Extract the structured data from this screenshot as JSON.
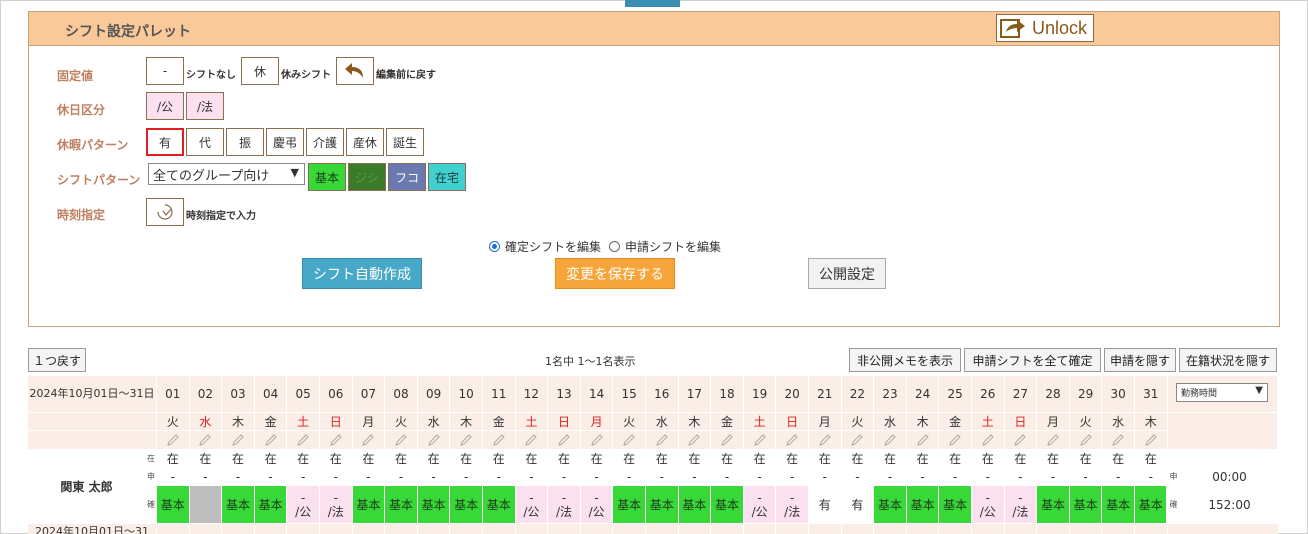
{
  "palette": {
    "title": "シフト設定パレット",
    "unlock_label": "Unlock",
    "labels": {
      "fixed": "固定値",
      "holiday_type": "休日区分",
      "leave_pattern": "休暇パターン",
      "shift_pattern": "シフトパターン",
      "time_spec": "時刻指定"
    },
    "fixed": {
      "dash": "-",
      "no_shift_text": "シフトなし",
      "rest": "休",
      "rest_text": "休みシフト",
      "revert_text": "編集前に戻す"
    },
    "holiday_types": [
      "/公",
      "/法"
    ],
    "leave_patterns": [
      "有",
      "代",
      "振",
      "慶弔",
      "介護",
      "産休",
      "誕生"
    ],
    "shift_select": "全てのグループ向け",
    "shift_patterns": [
      {
        "label": "基本",
        "bg": "#38d838",
        "fg": "#1a3a1a"
      },
      {
        "label": "ジシ",
        "bg": "#3a7a2a",
        "fg": "#5a9a4a"
      },
      {
        "label": "フコ",
        "bg": "#6a7ab0",
        "fg": "#ffffff"
      },
      {
        "label": "在宅",
        "bg": "#40d0d0",
        "fg": "#1a3a3a"
      }
    ],
    "time_text": "時刻指定で入力",
    "radio_confirmed": "確定シフトを編集",
    "radio_requested": "申請シフトを編集",
    "btn_auto": "シフト自動作成",
    "btn_save": "変更を保存する",
    "btn_publish": "公開設定"
  },
  "toolbar": {
    "back": "１つ戻す",
    "count": "1名中 1～1名表示",
    "show_memo": "非公開メモを表示",
    "confirm_all": "申請シフトを全て確定",
    "hide_request": "申請を隠す",
    "hide_status": "在籍状況を隠す"
  },
  "grid": {
    "date_range": "2024年10月01日～31日",
    "days": [
      "01",
      "02",
      "03",
      "04",
      "05",
      "06",
      "07",
      "08",
      "09",
      "10",
      "11",
      "12",
      "13",
      "14",
      "15",
      "16",
      "17",
      "18",
      "19",
      "20",
      "21",
      "22",
      "23",
      "24",
      "25",
      "26",
      "27",
      "28",
      "29",
      "30",
      "31"
    ],
    "weekdays": [
      "火",
      "水",
      "木",
      "金",
      "土",
      "日",
      "月",
      "火",
      "水",
      "木",
      "金",
      "土",
      "日",
      "月",
      "火",
      "水",
      "木",
      "金",
      "土",
      "日",
      "月",
      "火",
      "水",
      "木",
      "金",
      "土",
      "日",
      "月",
      "火",
      "水",
      "木"
    ],
    "red_days": [
      1,
      4,
      5,
      11,
      12,
      13,
      18,
      19,
      25,
      26
    ],
    "employee": "関東 太郎",
    "row_labels": {
      "status": "在",
      "request": "申",
      "confirmed": "確"
    },
    "status_value": "在",
    "request_value": "-",
    "shifts": [
      {
        "t": "g",
        "a": "基本"
      },
      {
        "t": "gray",
        "a": ""
      },
      {
        "t": "g",
        "a": "基本"
      },
      {
        "t": "g",
        "a": "基本"
      },
      {
        "t": "p",
        "a": "-",
        "b": "/公"
      },
      {
        "t": "p",
        "a": "-",
        "b": "/法"
      },
      {
        "t": "g",
        "a": "基本"
      },
      {
        "t": "g",
        "a": "基本"
      },
      {
        "t": "g",
        "a": "基本"
      },
      {
        "t": "g",
        "a": "基本"
      },
      {
        "t": "g",
        "a": "基本"
      },
      {
        "t": "p",
        "a": "-",
        "b": "/公"
      },
      {
        "t": "p",
        "a": "-",
        "b": "/法"
      },
      {
        "t": "p",
        "a": "-",
        "b": "/公"
      },
      {
        "t": "g",
        "a": "基本"
      },
      {
        "t": "g",
        "a": "基本"
      },
      {
        "t": "g",
        "a": "基本"
      },
      {
        "t": "g",
        "a": "基本"
      },
      {
        "t": "p",
        "a": "-",
        "b": "/公"
      },
      {
        "t": "p",
        "a": "-",
        "b": "/法"
      },
      {
        "t": "w",
        "a": "有"
      },
      {
        "t": "w",
        "a": "有"
      },
      {
        "t": "g",
        "a": "基本"
      },
      {
        "t": "g",
        "a": "基本"
      },
      {
        "t": "g",
        "a": "基本"
      },
      {
        "t": "p",
        "a": "-",
        "b": "/公"
      },
      {
        "t": "p",
        "a": "-",
        "b": "/法"
      },
      {
        "t": "g",
        "a": "基本"
      },
      {
        "t": "g",
        "a": "基本"
      },
      {
        "t": "g",
        "a": "基本"
      },
      {
        "t": "g",
        "a": "基本"
      }
    ],
    "right_select": "勤務時間",
    "right_request_label": "申",
    "right_confirmed_label": "確",
    "right_request_time": "00:00",
    "right_confirmed_time": "152:00",
    "next_date_range": "2024年10月01日～31"
  }
}
